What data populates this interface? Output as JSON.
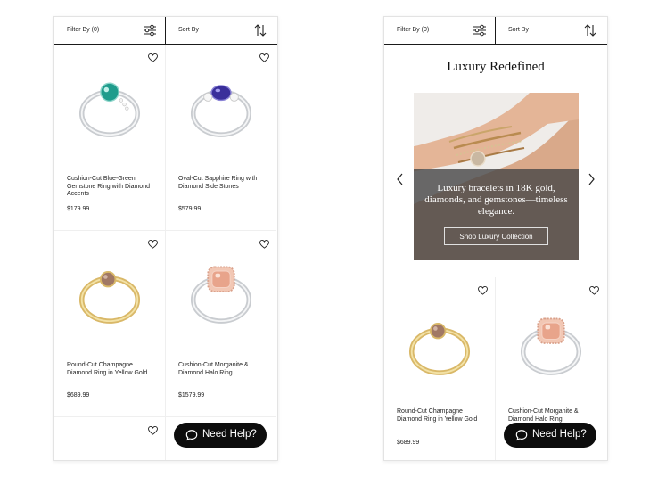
{
  "toolbar": {
    "filter_label": "Filter By (0)",
    "sort_label": "Sort By"
  },
  "products": [
    {
      "name": "Cushion-Cut Blue-Green Gemstone Ring with Diamond Accents",
      "price": "$179.99",
      "stone_color": "#1f9c8c",
      "metal": "white-gold"
    },
    {
      "name": "Oval-Cut Sapphire Ring with Diamond Side Stones",
      "price": "$579.99",
      "stone_color": "#3a2f9b",
      "metal": "white-gold"
    },
    {
      "name": "Round-Cut Champagne Diamond Ring in Yellow Gold",
      "price": "$689.99",
      "stone_color": "#a07865",
      "metal": "yellow-gold"
    },
    {
      "name": "Cushion-Cut Morganite & Diamond Halo Ring",
      "price": "$1579.99",
      "stone_color": "#e8a48b",
      "metal": "white-gold"
    }
  ],
  "promo": {
    "title": "Luxury Redefined",
    "text": "Luxury bracelets in 18K gold, diamonds, and gemstones—timeless elegance.",
    "cta": "Shop Luxury Collection"
  },
  "help_button": {
    "label": "Need Help?"
  },
  "colors": {
    "help_bg": "#0d0d0d",
    "overlay": "#464646",
    "border": "#1a1a1a"
  },
  "icons": {
    "filter": "sliders-icon",
    "sort": "sort-arrows-icon",
    "wishlist": "heart-icon",
    "chat": "chat-bubble-icon",
    "prev": "chevron-left-icon",
    "next": "chevron-right-icon"
  }
}
